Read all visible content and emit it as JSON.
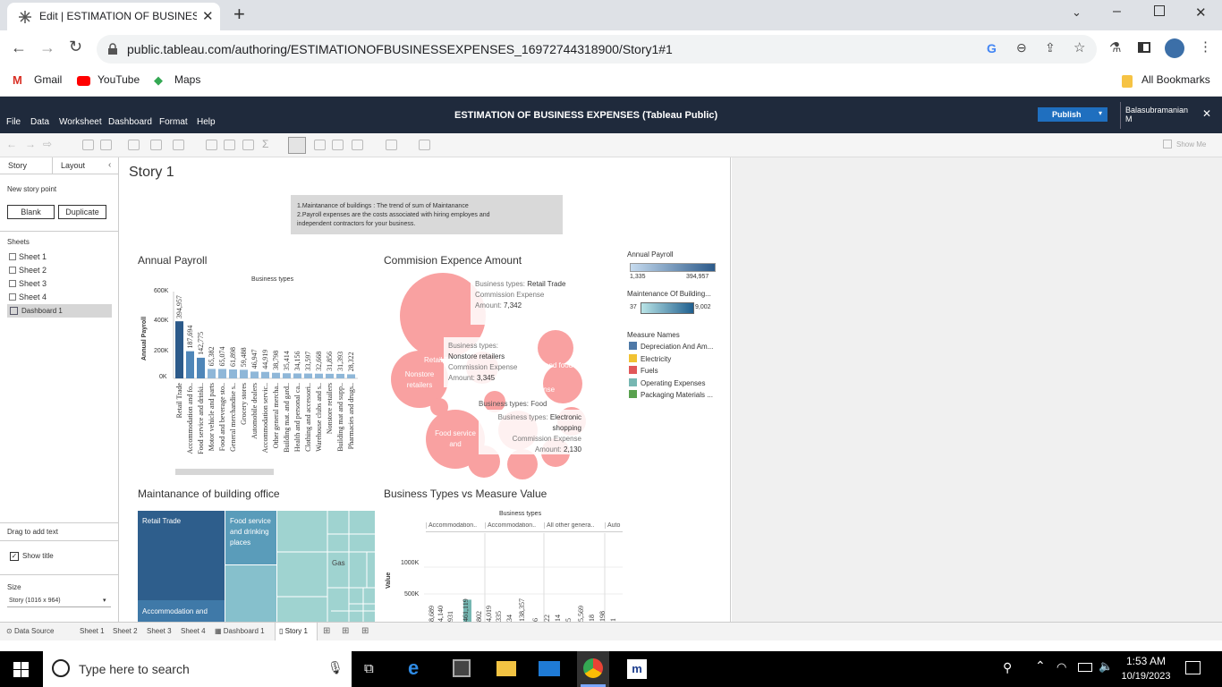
{
  "browser": {
    "tab_title": "Edit | ESTIMATION OF BUSINESS",
    "url": "public.tableau.com/authoring/ESTIMATIONOFBUSINESSEXPENSES_16972744318900/Story1#1",
    "bookmarks": [
      "Gmail",
      "YouTube",
      "Maps"
    ],
    "all_bookmarks": "All Bookmarks"
  },
  "app": {
    "title": "ESTIMATION OF BUSINESS EXPENSES (Tableau Public)",
    "menu": [
      "File",
      "Data",
      "Worksheet",
      "Dashboard",
      "Format",
      "Help"
    ],
    "publish": "Publish",
    "user": "Balasubramanian M",
    "show_me": "Show Me"
  },
  "left": {
    "tabs": [
      "Story",
      "Layout"
    ],
    "new_story_point": "New story point",
    "blank": "Blank",
    "duplicate": "Duplicate",
    "sheets_header": "Sheets",
    "sheets": [
      "Sheet 1",
      "Sheet 2",
      "Sheet 3",
      "Sheet 4",
      "Dashboard 1"
    ],
    "drag_text": "Drag to add text",
    "show_title": "Show title",
    "size_label": "Size",
    "size_value": "Story (1016 x 964)"
  },
  "story": {
    "title": "Story 1",
    "caption_line1": "1.Maintanance of buildings : The trend of sum of Maintanance",
    "caption_line2": "2.Payroll  expenses are the costs associated with hiring employes and",
    "caption_line3": "independent contractors for  your business."
  },
  "charts": {
    "payroll_title": "Annual Payroll",
    "commission_title": "Commision  Expence Amount",
    "maint_title": "Maintanance of building office",
    "types_title": "Business Types  vs  Measure Value"
  },
  "chart_data": [
    {
      "type": "bar",
      "title": "Annual Payroll",
      "header": "Business types",
      "ylabel": "Annual Payroll",
      "yticks": [
        "600K",
        "400K",
        "200K",
        "0K"
      ],
      "ylim": [
        0,
        600000
      ],
      "categories": [
        "Retail Trade",
        "Accommodation and fo..",
        "Food service and drinki..",
        "Motor vehicle and parts",
        "Food and beverage sto..",
        "General merchandise s..",
        "Grocery stores",
        "Automobile dealers",
        "Accommodation servic..",
        "Other general mercha..",
        "Building mat. and gard..",
        "Health and personal ca..",
        "Clothing and accessori..",
        "Warehouse clubs and s..",
        "Nonstore retailers",
        "Building mat and supp..",
        "Pharmacies and drugs.."
      ],
      "values": [
        394957,
        187694,
        142775,
        65382,
        65074,
        61898,
        59488,
        46947,
        44919,
        38798,
        35414,
        34156,
        33597,
        32668,
        31856,
        31393,
        28322
      ],
      "labels": [
        "394,957",
        "187,694",
        "142,775",
        "65,382",
        "65,074",
        "61,898",
        "59,488",
        "46,947",
        "44,919",
        "38,798",
        "35,414",
        "34,156",
        "33,597",
        "32,668",
        "31,856",
        "31,393",
        "28,322"
      ]
    },
    {
      "type": "bubble",
      "title": "Commision  Expence Amount",
      "labels": [
        "Retail Trade",
        "Nonstore retailers",
        "Food service and"
      ],
      "tooltips": [
        {
          "type_label": "Business types:",
          "type": "Retail Trade",
          "measure": "Commission Expense",
          "amount_label": "Amount:",
          "amount": "7,342"
        },
        {
          "type_label": "Business types:",
          "type": "Nonstore retailers",
          "measure": "Commission Expense",
          "amount_label": "Amount:",
          "amount": "3,345"
        },
        {
          "type_label": "Business types:",
          "type": "Electronic shopping",
          "measure": "Commission Expense",
          "amount_label": "Amount:",
          "amount": "2,130"
        }
      ],
      "fragments": [
        "and food",
        "Expense",
        "Business types: Food"
      ]
    },
    {
      "type": "treemap",
      "title": "Maintanance of building office",
      "labels": [
        "Retail Trade",
        "Food service and drinking places",
        "Gas",
        "Accommodation and"
      ]
    },
    {
      "type": "bar",
      "title": "Business Types  vs  Measure Value",
      "header": "Business types",
      "columns": [
        "Accommodation..",
        "Accommodation..",
        "All other genera..",
        "Auto"
      ],
      "ylabel": "Value",
      "yticks": [
        "1000K",
        "500K"
      ],
      "ylim": [
        0,
        1300000
      ],
      "bar_values": [
        461119,
        138357
      ],
      "value_labels": [
        "8,689",
        "4,140",
        "931",
        "461,119",
        "802",
        "4,019",
        "335",
        "34",
        "138,357",
        "6",
        "22",
        "14",
        "5",
        "5,569",
        "18",
        "198",
        "1"
      ]
    }
  ],
  "legends": {
    "payroll": {
      "title": "Annual Payroll",
      "min": "1,335",
      "max": "394,957"
    },
    "maintenance": {
      "title": "Maintenance Of Building...",
      "min": "37",
      "max": "9,002"
    },
    "measures": {
      "title": "Measure Names",
      "items": [
        {
          "name": "Depreciation And Am...",
          "color": "#4e79a7"
        },
        {
          "name": "Electricity",
          "color": "#f1c232"
        },
        {
          "name": "Fuels",
          "color": "#e15759"
        },
        {
          "name": "Operating Expenses",
          "color": "#76b7b2"
        },
        {
          "name": "Packaging Materials ...",
          "color": "#59a14f"
        }
      ]
    }
  },
  "bottom_tabs": [
    "Data Source",
    "Sheet 1",
    "Sheet 2",
    "Sheet 3",
    "Sheet 4",
    "Dashboard 1",
    "Story 1"
  ],
  "taskbar": {
    "search": "Type here to search",
    "time": "1:53 AM",
    "date": "10/19/2023"
  }
}
